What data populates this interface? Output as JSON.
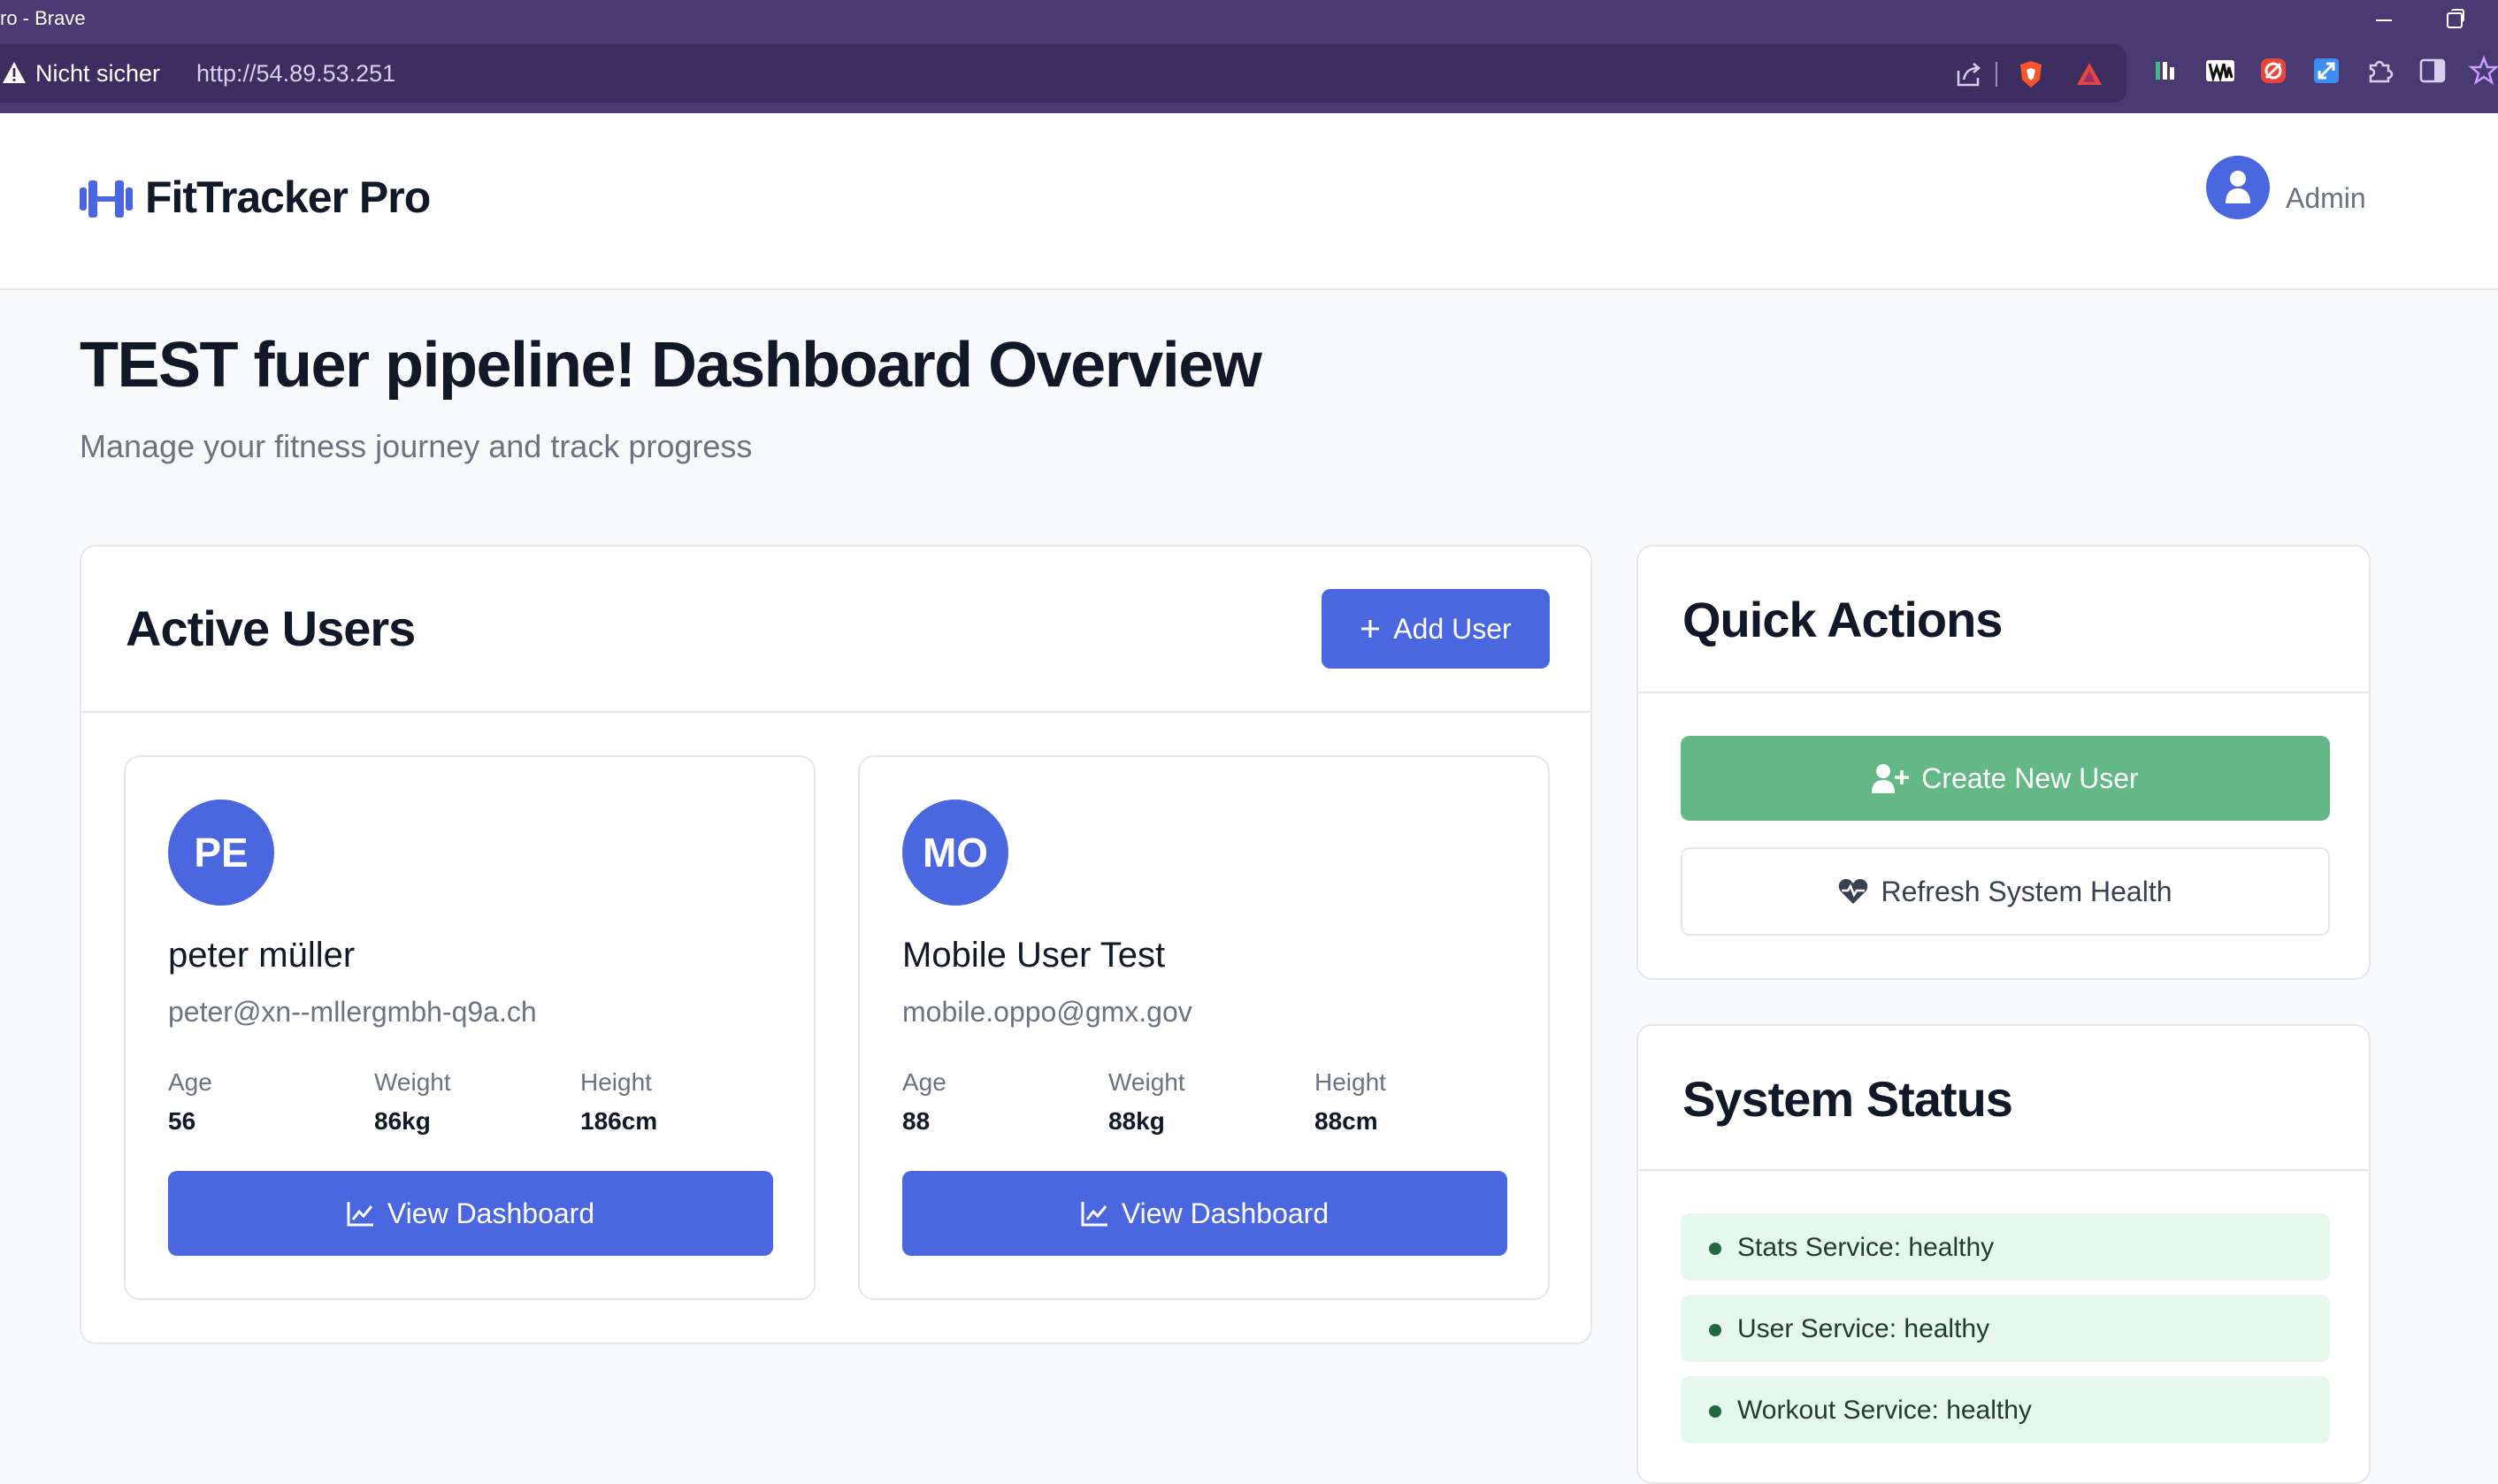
{
  "browser": {
    "window_title": "ro - Brave",
    "security_label": "Nicht sicher",
    "url": "http://54.89.53.251",
    "toolbar_icons": [
      "share-icon",
      "brave-shields-icon",
      "brave-rewards-icon"
    ],
    "extension_icons": [
      "extension-bar-icon",
      "extension-w-icon",
      "extension-red-icon",
      "extension-expand-icon",
      "puzzle-icon",
      "sidebar-icon",
      "bookmark-star-icon"
    ]
  },
  "header": {
    "brand": "FitTracker Pro",
    "user_label": "Admin"
  },
  "page": {
    "title": "TEST fuer pipeline! Dashboard Overview",
    "subtitle": "Manage your fitness journey and track progress"
  },
  "active_users": {
    "title": "Active Users",
    "add_button": "Add User",
    "users": [
      {
        "initials": "PE",
        "name": "peter müller",
        "email": "peter@xn--mllergmbh-q9a.ch",
        "age_label": "Age",
        "age": "56",
        "weight_label": "Weight",
        "weight": "86kg",
        "height_label": "Height",
        "height": "186cm",
        "button": "View Dashboard"
      },
      {
        "initials": "MO",
        "name": "Mobile User Test",
        "email": "mobile.oppo@gmx.gov",
        "age_label": "Age",
        "age": "88",
        "weight_label": "Weight",
        "weight": "88kg",
        "height_label": "Height",
        "height": "88cm",
        "button": "View Dashboard"
      }
    ]
  },
  "quick_actions": {
    "title": "Quick Actions",
    "create_user": "Create New User",
    "refresh_health": "Refresh System Health"
  },
  "system_status": {
    "title": "System Status",
    "services": [
      {
        "text": "Stats Service: healthy"
      },
      {
        "text": "User Service: healthy"
      },
      {
        "text": "Workout Service: healthy"
      }
    ]
  },
  "colors": {
    "primary": "#4a67e0",
    "success": "#63b886",
    "status_bg": "#e6f8ec",
    "browser_chrome": "#4a3a72"
  }
}
